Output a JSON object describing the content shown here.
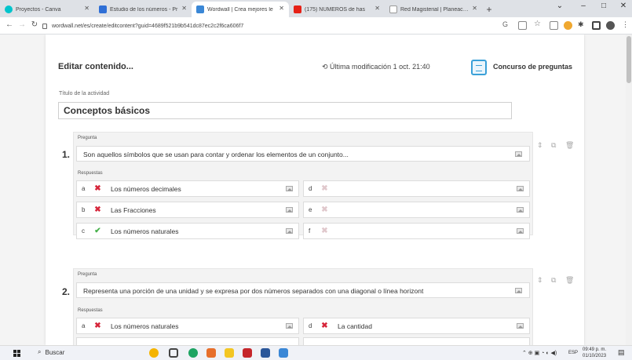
{
  "browser": {
    "tabs": [
      {
        "label": "Proyectos - Canva",
        "color": "#00c4cc",
        "active": false
      },
      {
        "label": "Estudio de los números - Pr",
        "color": "#2f6fd6",
        "active": false
      },
      {
        "label": "Wordwall | Crea mejores le",
        "color": "#3a87d6",
        "active": true
      },
      {
        "label": "(175) NÚMEROS de has",
        "color": "#e62117",
        "active": false
      },
      {
        "label": "Red Magisterial | Planeacion",
        "color": "#ffffff",
        "active": false
      }
    ],
    "new_tab": "+",
    "window_controls": {
      "menu": "⌄",
      "minimize": "–",
      "maximize": "□",
      "close": "✕"
    },
    "url": "wordwall.net/es/create/editcontent?guid=4689f521b9b541dc87ec2c2f6ca606f7"
  },
  "editor": {
    "heading": "Editar contenido...",
    "last_modified": "Última modificación 1 oct. 21:40",
    "template_name": "Concurso de preguntas",
    "activity_title_label": "Título de la actividad",
    "activity_title": "Conceptos básicos",
    "question_label": "Pregunta",
    "answers_label": "Respuestas"
  },
  "questions": [
    {
      "number": "1.",
      "text": "Son aquellos símbolos que se usan para contar y ordenar los elementos de un conjunto...",
      "answers": [
        {
          "letter": "a",
          "text": "Los números decimales",
          "state": "wrong"
        },
        {
          "letter": "b",
          "text": "Las Fracciones",
          "state": "wrong"
        },
        {
          "letter": "c",
          "text": "Los números naturales",
          "state": "right"
        },
        {
          "letter": "d",
          "text": "",
          "state": "empty"
        },
        {
          "letter": "e",
          "text": "",
          "state": "empty"
        },
        {
          "letter": "f",
          "text": "",
          "state": "empty"
        }
      ]
    },
    {
      "number": "2.",
      "text": "Representa una porción de una unidad y se expresa por dos números separados con una diagonal o línea horizont",
      "answers": [
        {
          "letter": "a",
          "text": "Los números naturales",
          "state": "wrong"
        },
        {
          "letter": "d",
          "text": "La cantidad",
          "state": "wrong"
        }
      ]
    }
  ],
  "taskbar": {
    "search": "Buscar",
    "language": "ESP",
    "time": "09:49 p. m.",
    "date": "01/10/2023"
  },
  "colors": {
    "accent": "#3aa0d8",
    "wrong": "#d6253a",
    "right": "#47b04b"
  }
}
